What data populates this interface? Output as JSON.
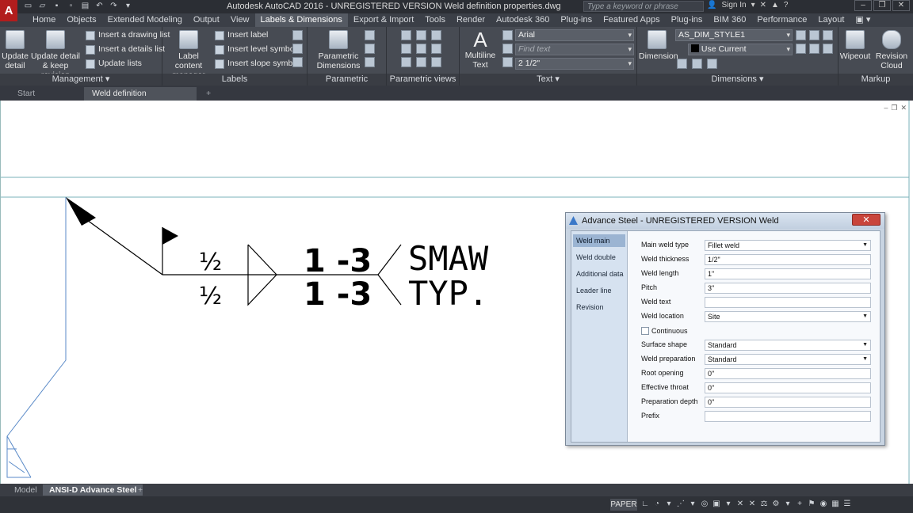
{
  "window": {
    "title": "Autodesk AutoCAD 2016 - UNREGISTERED VERSION    Weld definition properties.dwg",
    "search_placeholder": "Type a keyword or phrase",
    "sign_in": "Sign In"
  },
  "ribbon_tabs": [
    "Home",
    "Objects",
    "Extended Modeling",
    "Output",
    "View",
    "Labels & Dimensions",
    "Export & Import",
    "Tools",
    "Render",
    "Autodesk 360",
    "Plug-ins",
    "Featured Apps",
    "Plug-ins",
    "BIM 360",
    "Performance",
    "Layout"
  ],
  "ribbon": {
    "management": {
      "title": "Management",
      "update_detail": "Update detail",
      "update_keep": "Update detail & keep revision",
      "insert_drawing_list": "Insert a drawing list",
      "insert_details_list": "Insert a details list",
      "update_lists": "Update lists"
    },
    "labels": {
      "title": "Labels",
      "label_content_manager": "Label content manager",
      "insert_label": "Insert label",
      "insert_level_symbol": "Insert level symbol",
      "insert_slope_symbol": "Insert slope symbol"
    },
    "parametric_dimensions": {
      "title": "Parametric Dimensions",
      "button": "Parametric Dimensions"
    },
    "parametric_views": {
      "title": "Parametric views"
    },
    "text": {
      "title": "Text",
      "multiline_text": "Multiline Text",
      "font": "Arial",
      "find_placeholder": "Find text",
      "height": "2 1/2\""
    },
    "dimensions": {
      "title": "Dimensions",
      "dimension": "Dimension",
      "dim_style": "AS_DIM_STYLE1",
      "use_current": "Use Current"
    },
    "markup": {
      "title": "Markup",
      "wipeout": "Wipeout",
      "revision_cloud": "Revision Cloud"
    }
  },
  "doc_tabs": {
    "start": "Start",
    "active": "Weld definition properties*",
    "close": "×",
    "add": "+"
  },
  "weld_symbol": {
    "size_top": "½",
    "size_bottom": "½",
    "length_pitch_top": "1 -3",
    "length_pitch_bottom": "1 -3",
    "tail_top": "SMAW",
    "tail_bottom": "TYP."
  },
  "dialog": {
    "title": "Advance Steel - UNREGISTERED VERSION   Weld",
    "close": "✕",
    "side_items": [
      "Weld main",
      "Weld double",
      "Additional data",
      "Leader line",
      "Revision"
    ],
    "fields": {
      "main_weld_type": {
        "label": "Main weld type",
        "value": "Fillet weld"
      },
      "weld_thickness": {
        "label": "Weld thickness",
        "value": "1/2\""
      },
      "weld_length": {
        "label": "Weld length",
        "value": "1\""
      },
      "pitch": {
        "label": "Pitch",
        "value": "3\""
      },
      "weld_text": {
        "label": "Weld text",
        "value": ""
      },
      "weld_location": {
        "label": "Weld location",
        "value": "Site"
      },
      "continuous": {
        "label": "Continuous"
      },
      "surface_shape": {
        "label": "Surface shape",
        "value": "Standard"
      },
      "weld_preparation": {
        "label": "Weld preparation",
        "value": "Standard"
      },
      "root_opening": {
        "label": "Root opening",
        "value": "0\""
      },
      "effective_throat": {
        "label": "Effective throat",
        "value": "0\""
      },
      "preparation_depth": {
        "label": "Preparation depth",
        "value": "0\""
      },
      "prefix": {
        "label": "Prefix",
        "value": ""
      }
    }
  },
  "layout_tabs": {
    "model": "Model",
    "active": "ANSI-D Advance Steel",
    "add": "+"
  },
  "status": {
    "paper": "PAPER"
  }
}
